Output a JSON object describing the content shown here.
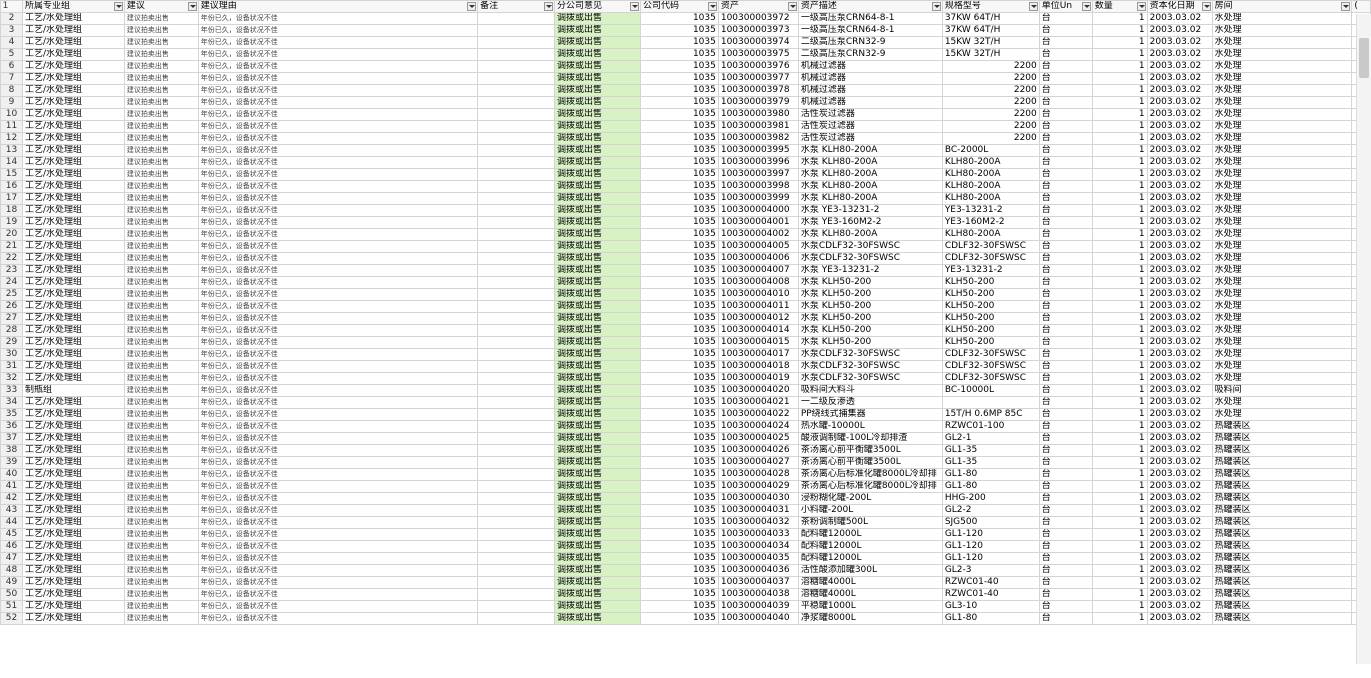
{
  "headers": [
    "所属专业组",
    "建议",
    "建议理由",
    "备注",
    "分公司意见",
    "公司代码",
    "资产",
    "资产描述",
    "规格型号",
    "单位Un",
    "数量",
    "资本化日期",
    "房间",
    "("
  ],
  "rows": [
    {
      "r": "2",
      "g": "工艺/水处理组",
      "s": "建议拍卖出售",
      "y": "年份已久，设备状况不佳",
      "o": "调拨或出售",
      "c": "1035",
      "a": "100300003972",
      "d": "一级高压泵CRN64-8-1",
      "m": "37KW  64T/H",
      "u": "台",
      "q": "1",
      "t": "2003.03.02",
      "rm": "水处理"
    },
    {
      "r": "3",
      "g": "工艺/水处理组",
      "s": "建议拍卖出售",
      "y": "年份已久，设备状况不佳",
      "o": "调拨或出售",
      "c": "1035",
      "a": "100300003973",
      "d": "一级高压泵CRN64-8-1",
      "m": "37KW  64T/H",
      "u": "台",
      "q": "1",
      "t": "2003.03.02",
      "rm": "水处理"
    },
    {
      "r": "4",
      "g": "工艺/水处理组",
      "s": "建议拍卖出售",
      "y": "年份已久，设备状况不佳",
      "o": "调拨或出售",
      "c": "1035",
      "a": "100300003974",
      "d": "二级高压泵CRN32-9",
      "m": "15KW  32T/H",
      "u": "台",
      "q": "1",
      "t": "2003.03.02",
      "rm": "水处理"
    },
    {
      "r": "5",
      "g": "工艺/水处理组",
      "s": "建议拍卖出售",
      "y": "年份已久，设备状况不佳",
      "o": "调拨或出售",
      "c": "1035",
      "a": "100300003975",
      "d": "二级高压泵CRN32-9",
      "m": "15KW  32T/H",
      "u": "台",
      "q": "1",
      "t": "2003.03.02",
      "rm": "水处理"
    },
    {
      "r": "6",
      "g": "工艺/水处理组",
      "s": "建议拍卖出售",
      "y": "年份已久，设备状况不佳",
      "o": "调拨或出售",
      "c": "1035",
      "a": "100300003976",
      "d": "机械过滤器",
      "m": "2200",
      "mr": true,
      "u": "台",
      "q": "1",
      "t": "2003.03.02",
      "rm": "水处理"
    },
    {
      "r": "7",
      "g": "工艺/水处理组",
      "s": "建议拍卖出售",
      "y": "年份已久，设备状况不佳",
      "o": "调拨或出售",
      "c": "1035",
      "a": "100300003977",
      "d": "机械过滤器",
      "m": "2200",
      "mr": true,
      "u": "台",
      "q": "1",
      "t": "2003.03.02",
      "rm": "水处理"
    },
    {
      "r": "8",
      "g": "工艺/水处理组",
      "s": "建议拍卖出售",
      "y": "年份已久，设备状况不佳",
      "o": "调拨或出售",
      "c": "1035",
      "a": "100300003978",
      "d": "机械过滤器",
      "m": "2200",
      "mr": true,
      "u": "台",
      "q": "1",
      "t": "2003.03.02",
      "rm": "水处理"
    },
    {
      "r": "9",
      "g": "工艺/水处理组",
      "s": "建议拍卖出售",
      "y": "年份已久，设备状况不佳",
      "o": "调拨或出售",
      "c": "1035",
      "a": "100300003979",
      "d": "机械过滤器",
      "m": "2200",
      "mr": true,
      "u": "台",
      "q": "1",
      "t": "2003.03.02",
      "rm": "水处理"
    },
    {
      "r": "10",
      "g": "工艺/水处理组",
      "s": "建议拍卖出售",
      "y": "年份已久，设备状况不佳",
      "o": "调拨或出售",
      "c": "1035",
      "a": "100300003980",
      "d": "活性炭过滤器",
      "m": "2200",
      "mr": true,
      "u": "台",
      "q": "1",
      "t": "2003.03.02",
      "rm": "水处理"
    },
    {
      "r": "11",
      "g": "工艺/水处理组",
      "s": "建议拍卖出售",
      "y": "年份已久，设备状况不佳",
      "o": "调拨或出售",
      "c": "1035",
      "a": "100300003981",
      "d": "活性炭过滤器",
      "m": "2200",
      "mr": true,
      "u": "台",
      "q": "1",
      "t": "2003.03.02",
      "rm": "水处理"
    },
    {
      "r": "12",
      "g": "工艺/水处理组",
      "s": "建议拍卖出售",
      "y": "年份已久，设备状况不佳",
      "o": "调拨或出售",
      "c": "1035",
      "a": "100300003982",
      "d": "活性炭过滤器",
      "m": "2200",
      "mr": true,
      "u": "台",
      "q": "1",
      "t": "2003.03.02",
      "rm": "水处理"
    },
    {
      "r": "13",
      "g": "工艺/水处理组",
      "s": "建议拍卖出售",
      "y": "年份已久，设备状况不佳",
      "o": "调拨或出售",
      "c": "1035",
      "a": "100300003995",
      "d": "水泵 KLH80-200A",
      "m": "BC-2000L",
      "u": "台",
      "q": "1",
      "t": "2003.03.02",
      "rm": "水处理"
    },
    {
      "r": "14",
      "g": "工艺/水处理组",
      "s": "建议拍卖出售",
      "y": "年份已久，设备状况不佳",
      "o": "调拨或出售",
      "c": "1035",
      "a": "100300003996",
      "d": "水泵 KLH80-200A",
      "m": "KLH80-200A",
      "u": "台",
      "q": "1",
      "t": "2003.03.02",
      "rm": "水处理"
    },
    {
      "r": "15",
      "g": "工艺/水处理组",
      "s": "建议拍卖出售",
      "y": "年份已久，设备状况不佳",
      "o": "调拨或出售",
      "c": "1035",
      "a": "100300003997",
      "d": "水泵 KLH80-200A",
      "m": "KLH80-200A",
      "u": "台",
      "q": "1",
      "t": "2003.03.02",
      "rm": "水处理"
    },
    {
      "r": "16",
      "g": "工艺/水处理组",
      "s": "建议拍卖出售",
      "y": "年份已久，设备状况不佳",
      "o": "调拨或出售",
      "c": "1035",
      "a": "100300003998",
      "d": "水泵 KLH80-200A",
      "m": "KLH80-200A",
      "u": "台",
      "q": "1",
      "t": "2003.03.02",
      "rm": "水处理"
    },
    {
      "r": "17",
      "g": "工艺/水处理组",
      "s": "建议拍卖出售",
      "y": "年份已久，设备状况不佳",
      "o": "调拨或出售",
      "c": "1035",
      "a": "100300003999",
      "d": "水泵 KLH80-200A",
      "m": "KLH80-200A",
      "u": "台",
      "q": "1",
      "t": "2003.03.02",
      "rm": "水处理"
    },
    {
      "r": "18",
      "g": "工艺/水处理组",
      "s": "建议拍卖出售",
      "y": "年份已久，设备状况不佳",
      "o": "调拨或出售",
      "c": "1035",
      "a": "100300004000",
      "d": "水泵 YE3-13231-2",
      "m": "YE3-13231-2",
      "u": "台",
      "q": "1",
      "t": "2003.03.02",
      "rm": "水处理"
    },
    {
      "r": "19",
      "g": "工艺/水处理组",
      "s": "建议拍卖出售",
      "y": "年份已久，设备状况不佳",
      "o": "调拨或出售",
      "c": "1035",
      "a": "100300004001",
      "d": "水泵 YE3-160M2-2",
      "m": "YE3-160M2-2",
      "u": "台",
      "q": "1",
      "t": "2003.03.02",
      "rm": "水处理"
    },
    {
      "r": "20",
      "g": "工艺/水处理组",
      "s": "建议拍卖出售",
      "y": "年份已久，设备状况不佳",
      "o": "调拨或出售",
      "c": "1035",
      "a": "100300004002",
      "d": "水泵 KLH80-200A",
      "m": "KLH80-200A",
      "u": "台",
      "q": "1",
      "t": "2003.03.02",
      "rm": "水处理"
    },
    {
      "r": "21",
      "g": "工艺/水处理组",
      "s": "建议拍卖出售",
      "y": "年份已久，设备状况不佳",
      "o": "调拨或出售",
      "c": "1035",
      "a": "100300004005",
      "d": "水泵CDLF32-30FSWSC",
      "m": "CDLF32-30FSWSC",
      "u": "台",
      "q": "1",
      "t": "2003.03.02",
      "rm": "水处理"
    },
    {
      "r": "22",
      "g": "工艺/水处理组",
      "s": "建议拍卖出售",
      "y": "年份已久，设备状况不佳",
      "o": "调拨或出售",
      "c": "1035",
      "a": "100300004006",
      "d": "水泵CDLF32-30FSWSC",
      "m": "CDLF32-30FSWSC",
      "u": "台",
      "q": "1",
      "t": "2003.03.02",
      "rm": "水处理"
    },
    {
      "r": "23",
      "g": "工艺/水处理组",
      "s": "建议拍卖出售",
      "y": "年份已久，设备状况不佳",
      "o": "调拨或出售",
      "c": "1035",
      "a": "100300004007",
      "d": "水泵 YE3-13231-2",
      "m": "YE3-13231-2",
      "u": "台",
      "q": "1",
      "t": "2003.03.02",
      "rm": "水处理"
    },
    {
      "r": "24",
      "g": "工艺/水处理组",
      "s": "建议拍卖出售",
      "y": "年份已久，设备状况不佳",
      "o": "调拨或出售",
      "c": "1035",
      "a": "100300004008",
      "d": "水泵 KLH50-200",
      "m": "KLH50-200",
      "u": "台",
      "q": "1",
      "t": "2003.03.02",
      "rm": "水处理"
    },
    {
      "r": "25",
      "g": "工艺/水处理组",
      "s": "建议拍卖出售",
      "y": "年份已久，设备状况不佳",
      "o": "调拨或出售",
      "c": "1035",
      "a": "100300004010",
      "d": "水泵 KLH50-200",
      "m": "KLH50-200",
      "u": "台",
      "q": "1",
      "t": "2003.03.02",
      "rm": "水处理"
    },
    {
      "r": "26",
      "g": "工艺/水处理组",
      "s": "建议拍卖出售",
      "y": "年份已久，设备状况不佳",
      "o": "调拨或出售",
      "c": "1035",
      "a": "100300004011",
      "d": "水泵 KLH50-200",
      "m": "KLH50-200",
      "u": "台",
      "q": "1",
      "t": "2003.03.02",
      "rm": "水处理"
    },
    {
      "r": "27",
      "g": "工艺/水处理组",
      "s": "建议拍卖出售",
      "y": "年份已久，设备状况不佳",
      "o": "调拨或出售",
      "c": "1035",
      "a": "100300004012",
      "d": "水泵 KLH50-200",
      "m": "KLH50-200",
      "u": "台",
      "q": "1",
      "t": "2003.03.02",
      "rm": "水处理"
    },
    {
      "r": "28",
      "g": "工艺/水处理组",
      "s": "建议拍卖出售",
      "y": "年份已久，设备状况不佳",
      "o": "调拨或出售",
      "c": "1035",
      "a": "100300004014",
      "d": "水泵 KLH50-200",
      "m": "KLH50-200",
      "u": "台",
      "q": "1",
      "t": "2003.03.02",
      "rm": "水处理"
    },
    {
      "r": "29",
      "g": "工艺/水处理组",
      "s": "建议拍卖出售",
      "y": "年份已久，设备状况不佳",
      "o": "调拨或出售",
      "c": "1035",
      "a": "100300004015",
      "d": "水泵 KLH50-200",
      "m": "KLH50-200",
      "u": "台",
      "q": "1",
      "t": "2003.03.02",
      "rm": "水处理"
    },
    {
      "r": "30",
      "g": "工艺/水处理组",
      "s": "建议拍卖出售",
      "y": "年份已久，设备状况不佳",
      "o": "调拨或出售",
      "c": "1035",
      "a": "100300004017",
      "d": "水泵CDLF32-30FSWSC",
      "m": "CDLF32-30FSWSC",
      "u": "台",
      "q": "1",
      "t": "2003.03.02",
      "rm": "水处理"
    },
    {
      "r": "31",
      "g": "工艺/水处理组",
      "s": "建议拍卖出售",
      "y": "年份已久，设备状况不佳",
      "o": "调拨或出售",
      "c": "1035",
      "a": "100300004018",
      "d": "水泵CDLF32-30FSWSC",
      "m": "CDLF32-30FSWSC",
      "u": "台",
      "q": "1",
      "t": "2003.03.02",
      "rm": "水处理"
    },
    {
      "r": "32",
      "g": "工艺/水处理组",
      "s": "建议拍卖出售",
      "y": "年份已久，设备状况不佳",
      "o": "调拨或出售",
      "c": "1035",
      "a": "100300004019",
      "d": "水泵CDLF32-30FSWSC",
      "m": "CDLF32-30FSWSC",
      "u": "台",
      "q": "1",
      "t": "2003.03.02",
      "rm": "水处理"
    },
    {
      "r": "33",
      "g": "制瓶组",
      "s": "建议拍卖出售",
      "y": "年份已久，设备状况不佳",
      "o": "调拨或出售",
      "c": "1035",
      "a": "100300004020",
      "d": "吸料间大料斗",
      "m": "BC-10000L",
      "u": "台",
      "q": "1",
      "t": "2003.03.02",
      "rm": "吸料间"
    },
    {
      "r": "34",
      "g": "工艺/水处理组",
      "s": "建议拍卖出售",
      "y": "年份已久，设备状况不佳",
      "o": "调拨或出售",
      "c": "1035",
      "a": "100300004021",
      "d": "一二级反渗透",
      "m": "",
      "u": "台",
      "q": "1",
      "t": "2003.03.02",
      "rm": "水处理"
    },
    {
      "r": "35",
      "g": "工艺/水处理组",
      "s": "建议拍卖出售",
      "y": "年份已久，设备状况不佳",
      "o": "调拨或出售",
      "c": "1035",
      "a": "100300004022",
      "d": "PP绕线式捕集器",
      "m": "15T/H 0.6MP  85C",
      "u": "台",
      "q": "1",
      "t": "2003.03.02",
      "rm": "水处理"
    },
    {
      "r": "36",
      "g": "工艺/水处理组",
      "s": "建议拍卖出售",
      "y": "年份已久，设备状况不佳",
      "o": "调拨或出售",
      "c": "1035",
      "a": "100300004024",
      "d": "热水罐-10000L",
      "m": "RZWC01-100",
      "u": "台",
      "q": "1",
      "t": "2003.03.02",
      "rm": "热罐装区"
    },
    {
      "r": "37",
      "g": "工艺/水处理组",
      "s": "建议拍卖出售",
      "y": "年份已久，设备状况不佳",
      "o": "调拨或出售",
      "c": "1035",
      "a": "100300004025",
      "d": "酸液调制罐-100L冷却排渣",
      "m": "GL2-1",
      "u": "台",
      "q": "1",
      "t": "2003.03.02",
      "rm": "热罐装区"
    },
    {
      "r": "38",
      "g": "工艺/水处理组",
      "s": "建议拍卖出售",
      "y": "年份已久，设备状况不佳",
      "o": "调拨或出售",
      "c": "1035",
      "a": "100300004026",
      "d": "茶汤离心前平衡罐3500L",
      "m": "GL1-35",
      "u": "台",
      "q": "1",
      "t": "2003.03.02",
      "rm": "热罐装区"
    },
    {
      "r": "39",
      "g": "工艺/水处理组",
      "s": "建议拍卖出售",
      "y": "年份已久，设备状况不佳",
      "o": "调拨或出售",
      "c": "1035",
      "a": "100300004027",
      "d": "茶汤离心前平衡罐3500L",
      "m": "GL1-35",
      "u": "台",
      "q": "1",
      "t": "2003.03.02",
      "rm": "热罐装区"
    },
    {
      "r": "40",
      "g": "工艺/水处理组",
      "s": "建议拍卖出售",
      "y": "年份已久，设备状况不佳",
      "o": "调拨或出售",
      "c": "1035",
      "a": "100300004028",
      "d": "茶汤离心后标准化罐8000L冷却排",
      "m": "GL1-80",
      "u": "台",
      "q": "1",
      "t": "2003.03.02",
      "rm": "热罐装区"
    },
    {
      "r": "41",
      "g": "工艺/水处理组",
      "s": "建议拍卖出售",
      "y": "年份已久，设备状况不佳",
      "o": "调拨或出售",
      "c": "1035",
      "a": "100300004029",
      "d": "茶汤离心后标准化罐8000L冷却排",
      "m": "GL1-80",
      "u": "台",
      "q": "1",
      "t": "2003.03.02",
      "rm": "热罐装区"
    },
    {
      "r": "42",
      "g": "工艺/水处理组",
      "s": "建议拍卖出售",
      "y": "年份已久，设备状况不佳",
      "o": "调拨或出售",
      "c": "1035",
      "a": "100300004030",
      "d": "浸粉糊化罐-200L",
      "m": "HHG-200",
      "u": "台",
      "q": "1",
      "t": "2003.03.02",
      "rm": "热罐装区"
    },
    {
      "r": "43",
      "g": "工艺/水处理组",
      "s": "建议拍卖出售",
      "y": "年份已久，设备状况不佳",
      "o": "调拨或出售",
      "c": "1035",
      "a": "100300004031",
      "d": "小料罐-200L",
      "m": "GL2-2",
      "u": "台",
      "q": "1",
      "t": "2003.03.02",
      "rm": "热罐装区"
    },
    {
      "r": "44",
      "g": "工艺/水处理组",
      "s": "建议拍卖出售",
      "y": "年份已久，设备状况不佳",
      "o": "调拨或出售",
      "c": "1035",
      "a": "100300004032",
      "d": "茶粉调制罐500L",
      "m": "SJG500",
      "u": "台",
      "q": "1",
      "t": "2003.03.02",
      "rm": "热罐装区"
    },
    {
      "r": "45",
      "g": "工艺/水处理组",
      "s": "建议拍卖出售",
      "y": "年份已久，设备状况不佳",
      "o": "调拨或出售",
      "c": "1035",
      "a": "100300004033",
      "d": "配料罐12000L",
      "m": "GL1-120",
      "u": "台",
      "q": "1",
      "t": "2003.03.02",
      "rm": "热罐装区"
    },
    {
      "r": "46",
      "g": "工艺/水处理组",
      "s": "建议拍卖出售",
      "y": "年份已久，设备状况不佳",
      "o": "调拨或出售",
      "c": "1035",
      "a": "100300004034",
      "d": "配料罐12000L",
      "m": "GL1-120",
      "u": "台",
      "q": "1",
      "t": "2003.03.02",
      "rm": "热罐装区"
    },
    {
      "r": "47",
      "g": "工艺/水处理组",
      "s": "建议拍卖出售",
      "y": "年份已久，设备状况不佳",
      "o": "调拨或出售",
      "c": "1035",
      "a": "100300004035",
      "d": "配料罐12000L",
      "m": "GL1-120",
      "u": "台",
      "q": "1",
      "t": "2003.03.02",
      "rm": "热罐装区"
    },
    {
      "r": "48",
      "g": "工艺/水处理组",
      "s": "建议拍卖出售",
      "y": "年份已久，设备状况不佳",
      "o": "调拨或出售",
      "c": "1035",
      "a": "100300004036",
      "d": "活性酸添加罐300L",
      "m": "GL2-3",
      "u": "台",
      "q": "1",
      "t": "2003.03.02",
      "rm": "热罐装区"
    },
    {
      "r": "49",
      "g": "工艺/水处理组",
      "s": "建议拍卖出售",
      "y": "年份已久，设备状况不佳",
      "o": "调拨或出售",
      "c": "1035",
      "a": "100300004037",
      "d": "溶糖罐4000L",
      "m": "RZWC01-40",
      "u": "台",
      "q": "1",
      "t": "2003.03.02",
      "rm": "热罐装区"
    },
    {
      "r": "50",
      "g": "工艺/水处理组",
      "s": "建议拍卖出售",
      "y": "年份已久，设备状况不佳",
      "o": "调拨或出售",
      "c": "1035",
      "a": "100300004038",
      "d": "溶糖罐4000L",
      "m": "RZWC01-40",
      "u": "台",
      "q": "1",
      "t": "2003.03.02",
      "rm": "热罐装区"
    },
    {
      "r": "51",
      "g": "工艺/水处理组",
      "s": "建议拍卖出售",
      "y": "年份已久，设备状况不佳",
      "o": "调拨或出售",
      "c": "1035",
      "a": "100300004039",
      "d": "平稳罐1000L",
      "m": "GL3-10",
      "u": "台",
      "q": "1",
      "t": "2003.03.02",
      "rm": "热罐装区"
    },
    {
      "r": "52",
      "g": "工艺/水处理组",
      "s": "建议拍卖出售",
      "y": "年份已久，设备状况不佳",
      "o": "调拨或出售",
      "c": "1035",
      "a": "100300004040",
      "d": "净浆罐8000L",
      "m": "GL1-80",
      "u": "台",
      "q": "1",
      "t": "2003.03.02",
      "rm": "热罐装区"
    }
  ],
  "colors": {
    "header_highlight": "#ffff00",
    "opinion_fill": "#d9f2c5",
    "grid": "#d4d4d4"
  }
}
